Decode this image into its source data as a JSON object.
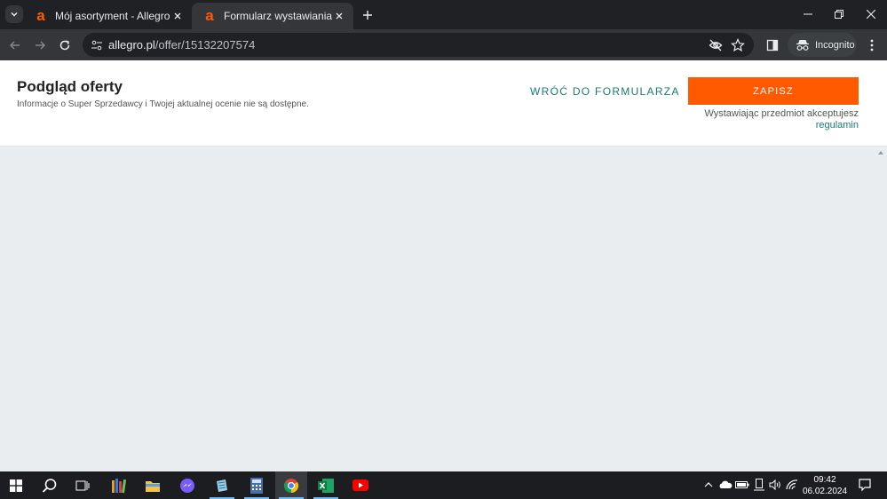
{
  "browser": {
    "tabs": [
      {
        "title": "Mój asortyment - Allegro",
        "favicon": "allegro-icon"
      },
      {
        "title": "Formularz wystawiania",
        "favicon": "allegro-icon"
      }
    ],
    "url_host": "allegro.pl",
    "url_path": "/offer/15132207574",
    "profile_label": "Incognito"
  },
  "header": {
    "title": "Podgląd oferty",
    "subtitle": "Informacje o Super Sprzedawcy i Twojej aktualnej ocenie nie są dostępne.",
    "back_link": "WRÓĆ DO FORMULARZA",
    "save_button": "ZAPISZ",
    "accept_text": "Wystawiając przedmiot akceptujesz",
    "regulamin_link": "regulamin"
  },
  "taskbar": {
    "time": "09:42",
    "date": "06.02.2024"
  },
  "colors": {
    "accent": "#ff5a00",
    "link": "#1c7a6e"
  }
}
